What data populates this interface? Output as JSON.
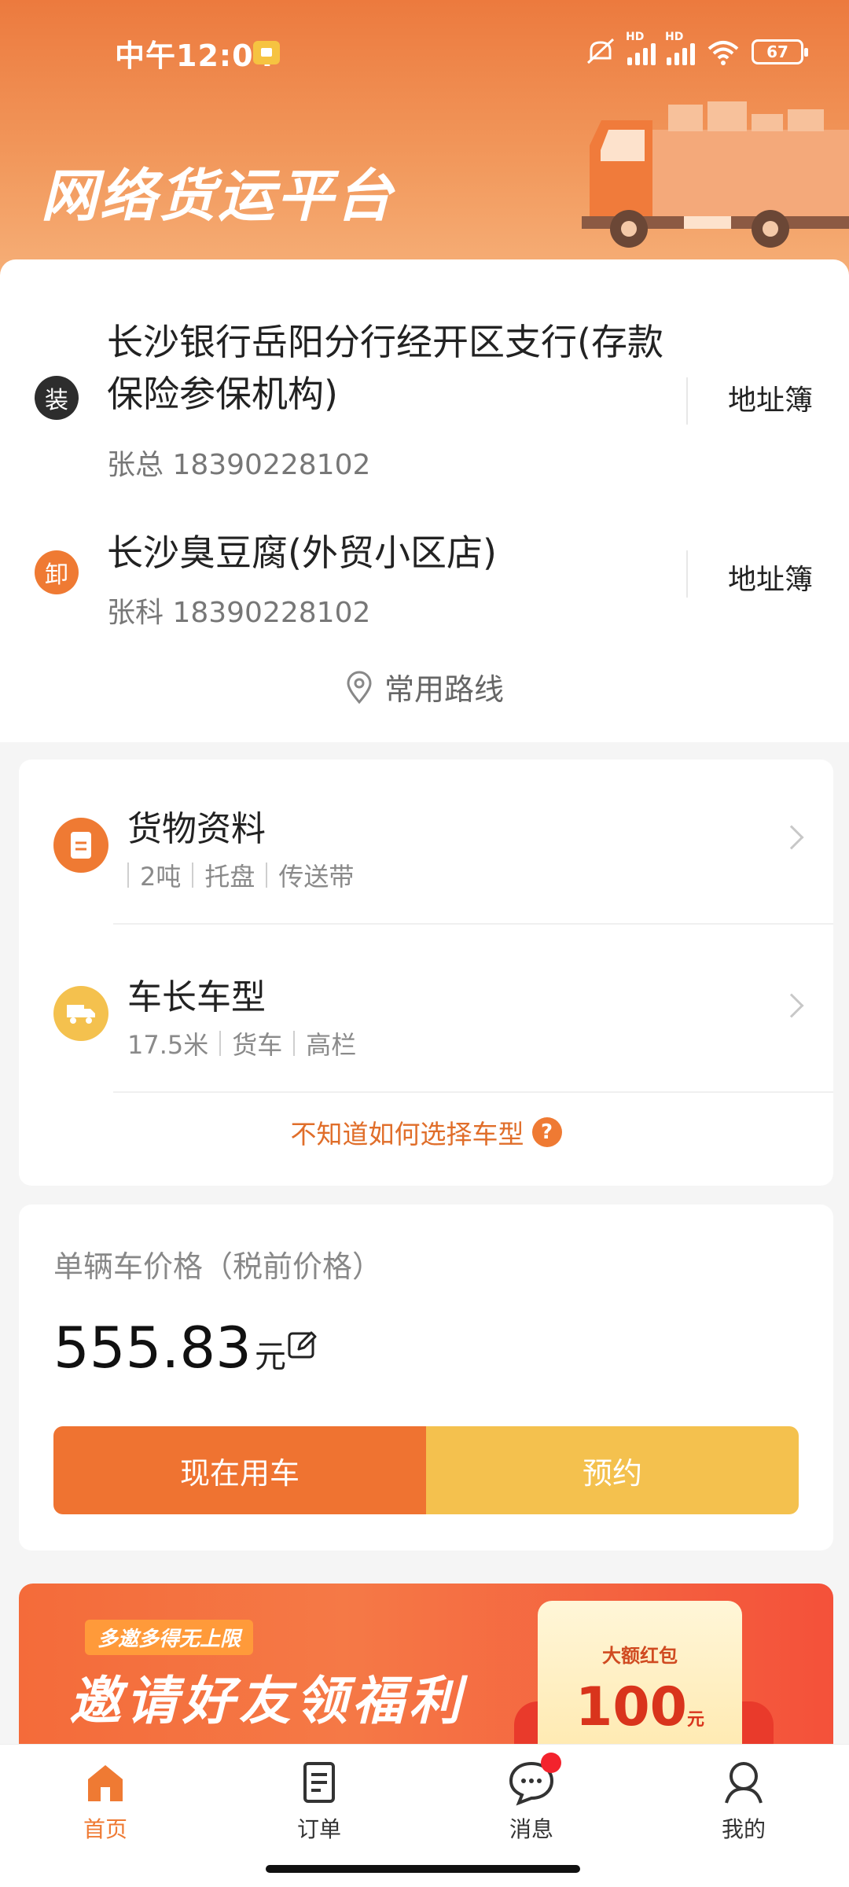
{
  "status_bar": {
    "time": "中午12:04",
    "battery": "67",
    "hd1": "HD",
    "hd2": "HD"
  },
  "header": {
    "title": "网络货运平台"
  },
  "addresses": {
    "load": {
      "badge": "装",
      "name": "长沙银行岳阳分行经开区支行(存款保险参保机构)",
      "contact": "张总 18390228102",
      "book_label": "地址簿"
    },
    "unload": {
      "badge": "卸",
      "name": "长沙臭豆腐(外贸小区店)",
      "contact": "张科 18390228102",
      "book_label": "地址簿"
    },
    "routes_label": "常用路线"
  },
  "cargo": {
    "title": "货物资料",
    "items": [
      "2吨",
      "托盘",
      "传送带"
    ]
  },
  "vehicle": {
    "title": "车长车型",
    "items": [
      "17.5米",
      "货车",
      "高栏"
    ]
  },
  "help_link": "不知道如何选择车型",
  "help_icon": "?",
  "price": {
    "label": "单辆车价格（税前价格）",
    "value": "555.83",
    "unit": "元"
  },
  "actions": {
    "now_label": "现在用车",
    "book_label": "预约"
  },
  "banner": {
    "tag": "多邀多得无上限",
    "headline": "邀请好友领福利",
    "envelope_tag": "大额红包",
    "envelope_amount": "100",
    "envelope_unit": "元"
  },
  "tabs": [
    {
      "label": "首页",
      "icon": "home-icon",
      "active": true
    },
    {
      "label": "订单",
      "icon": "order-icon",
      "active": false
    },
    {
      "label": "消息",
      "icon": "message-icon",
      "active": false
    },
    {
      "label": "我的",
      "icon": "profile-icon",
      "active": false
    }
  ],
  "colors": {
    "accent": "#ef7a33",
    "secondary": "#f4c14e"
  }
}
